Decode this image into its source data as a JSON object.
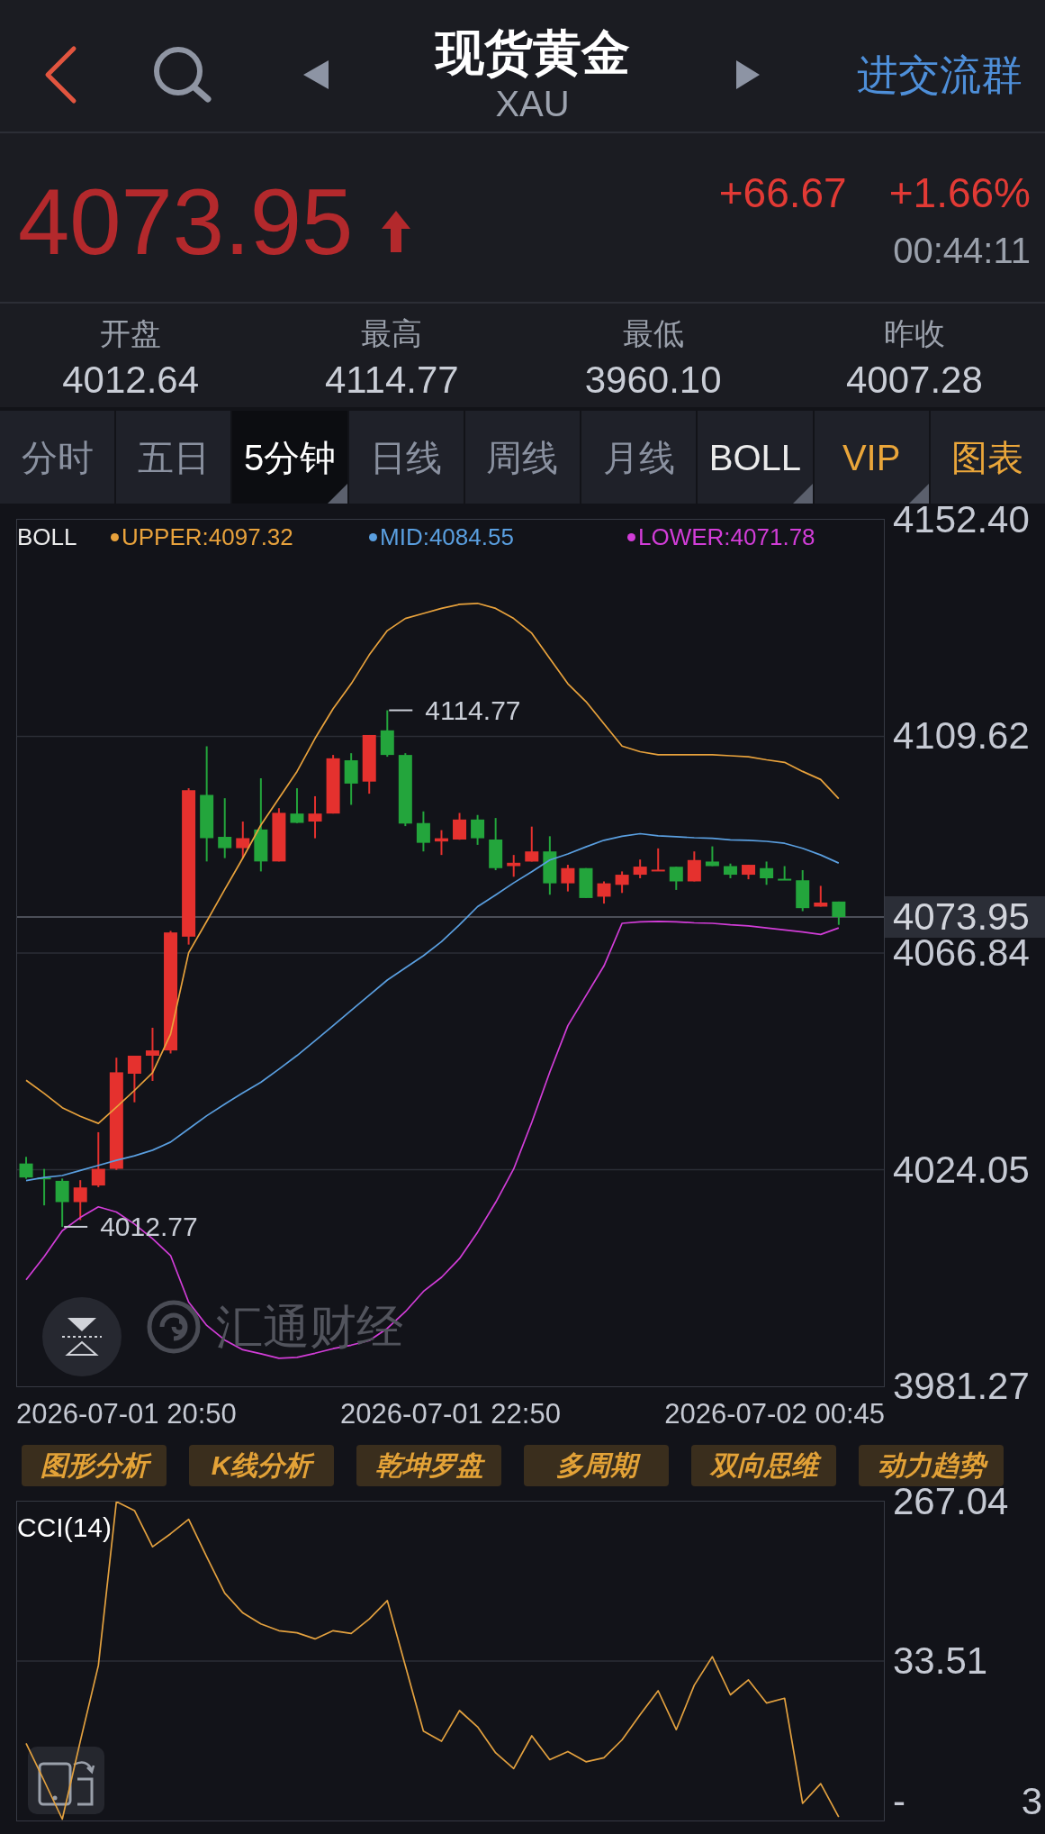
{
  "header": {
    "title": "现货黄金",
    "symbol": "XAU",
    "group_link": "进交流群"
  },
  "quote": {
    "price": "4073.95",
    "up": true,
    "change": "+66.67",
    "change_percent": "+1.66%",
    "time": "00:44:11"
  },
  "stats": [
    {
      "label": "开盘",
      "value": "4012.64"
    },
    {
      "label": "最高",
      "value": "4114.77"
    },
    {
      "label": "最低",
      "value": "3960.10"
    },
    {
      "label": "昨收",
      "value": "4007.28"
    }
  ],
  "tabs": [
    {
      "label": "分时",
      "selected": false,
      "kind": "period",
      "has_menu": false
    },
    {
      "label": "五日",
      "selected": false,
      "kind": "period",
      "has_menu": false
    },
    {
      "label": "5分钟",
      "selected": true,
      "kind": "period",
      "has_menu": true
    },
    {
      "label": "日线",
      "selected": false,
      "kind": "period",
      "has_menu": false
    },
    {
      "label": "周线",
      "selected": false,
      "kind": "period",
      "has_menu": false
    },
    {
      "label": "月线",
      "selected": false,
      "kind": "period",
      "has_menu": false
    },
    {
      "label": "BOLL",
      "selected": false,
      "kind": "indicator",
      "has_menu": true
    },
    {
      "label": "VIP",
      "selected": false,
      "kind": "premium",
      "has_menu": true
    },
    {
      "label": "图表",
      "selected": false,
      "kind": "premium",
      "has_menu": false
    }
  ],
  "main_chart": {
    "legend_title": "BOLL",
    "brand_mark": "汇通财经",
    "chart_data": {
      "type": "candlestick",
      "grid": true,
      "legend": "top",
      "categories": [
        null,
        null,
        null,
        null,
        null,
        null,
        null,
        null,
        null,
        null,
        null,
        null,
        null,
        null,
        null,
        null,
        null,
        null,
        null,
        null,
        null,
        null,
        null,
        null,
        null,
        null,
        null,
        null,
        null,
        null,
        null,
        null,
        null,
        null,
        null,
        null,
        null,
        null,
        null,
        null,
        null,
        null,
        null,
        null,
        null,
        null,
        null,
        null
      ],
      "ylim": [
        3981.27,
        4152.4
      ],
      "yticks": [
        {
          "value": 4152.4,
          "label": "4152.40"
        },
        {
          "value": 4109.62,
          "label": "4109.62"
        },
        {
          "value": 4066.84,
          "label": "4066.84"
        },
        {
          "value": 4024.05,
          "label": "4024.05"
        },
        {
          "value": 3981.27,
          "label": "3981.27"
        }
      ],
      "ohlc": [
        [
          4025.27,
          4026.58,
          4022.25,
          4022.51
        ],
        [
          4022.5,
          4024.2,
          4017.0,
          4022.4
        ],
        [
          4021.85,
          4022.3,
          4012.77,
          4017.65
        ],
        [
          4017.65,
          4021.98,
          4014.1,
          4020.54
        ],
        [
          4020.93,
          4031.45,
          4020.6,
          4024.22
        ],
        [
          4024.22,
          4046.17,
          4024.0,
          4043.28
        ],
        [
          4043.0,
          4046.56,
          4037.36,
          4046.56
        ],
        [
          4046.56,
          4052.08,
          4041.57,
          4047.6
        ],
        [
          4047.6,
          4071.2,
          4047.0,
          4070.9
        ],
        [
          4070.07,
          4099.38,
          4068.5,
          4098.99
        ],
        [
          4098.06,
          4107.66,
          4084.92,
          4089.52
        ],
        [
          4089.78,
          4097.41,
          4085.58,
          4087.55
        ],
        [
          4087.55,
          4092.8,
          4085.58,
          4089.52
        ],
        [
          4091.23,
          4101.35,
          4082.95,
          4084.92
        ],
        [
          4084.92,
          4095.44,
          4084.92,
          4094.52
        ],
        [
          4094.38,
          4099.38,
          4092.5,
          4092.54
        ],
        [
          4092.8,
          4097.8,
          4089.5,
          4094.38
        ],
        [
          4094.38,
          4105.95,
          4094.38,
          4105.29
        ],
        [
          4104.9,
          4106.3,
          4096.1,
          4100.3
        ],
        [
          4100.69,
          4109.89,
          4098.3,
          4109.89
        ],
        [
          4110.81,
          4114.77,
          4105.6,
          4105.95
        ],
        [
          4105.95,
          4106.3,
          4091.9,
          4092.4
        ],
        [
          4092.5,
          4094.8,
          4086.9,
          4088.6
        ],
        [
          4088.87,
          4091.1,
          4086.2,
          4089.5
        ],
        [
          4089.25,
          4094.5,
          4089.2,
          4093.2
        ],
        [
          4093.2,
          4094.1,
          4088.2,
          4089.5
        ],
        [
          4089.25,
          4093.5,
          4083.2,
          4083.6
        ],
        [
          4084.0,
          4086.2,
          4081.9,
          4084.66
        ],
        [
          4084.9,
          4091.8,
          4084.9,
          4086.9
        ],
        [
          4086.9,
          4089.9,
          4078.35,
          4080.6
        ],
        [
          4080.6,
          4084.26,
          4079.0,
          4083.6
        ],
        [
          4083.6,
          4083.6,
          4077.7,
          4077.7
        ],
        [
          4077.96,
          4080.98,
          4076.6,
          4080.6
        ],
        [
          4080.3,
          4082.95,
          4078.7,
          4082.3
        ],
        [
          4082.3,
          4085.3,
          4081.6,
          4083.9
        ],
        [
          4083.2,
          4087.5,
          4083.2,
          4083.3
        ],
        [
          4083.87,
          4083.87,
          4079.3,
          4080.98
        ],
        [
          4080.98,
          4086.9,
          4080.98,
          4085.2
        ],
        [
          4084.9,
          4087.9,
          4084.0,
          4084.0
        ],
        [
          4084.0,
          4084.5,
          4081.6,
          4082.3
        ],
        [
          4082.3,
          4084.26,
          4081.4,
          4084.26
        ],
        [
          4083.6,
          4084.9,
          4080.3,
          4081.6
        ],
        [
          4081.5,
          4084.0,
          4081.4,
          4081.4
        ],
        [
          4081.2,
          4083.2,
          4075.1,
          4075.7
        ],
        [
          4076.0,
          4080.1,
          4076.0,
          4076.8
        ],
        [
          4077.0,
          4077.0,
          4072.4,
          4073.95
        ],
        null,
        null
      ],
      "series": [
        {
          "name": "UPPER:4097.32",
          "type": "line",
          "color": "#e8a23c",
          "values": [
            4041.7,
            4039.1,
            4036.3,
            4034.6,
            4033.2,
            4036.4,
            4039.7,
            4043.2,
            4050.8,
            4066.9,
            4073.1,
            4079.4,
            4085.6,
            4092.1,
            4097.4,
            4102.7,
            4109.2,
            4115.1,
            4120.0,
            4125.7,
            4130.5,
            4132.9,
            4133.9,
            4134.9,
            4135.7,
            4135.9,
            4134.9,
            4132.9,
            4130.0,
            4125.0,
            4120.0,
            4116.5,
            4112.1,
            4107.7,
            4106.6,
            4106.0,
            4106.0,
            4106.0,
            4106.0,
            4105.8,
            4105.6,
            4105.0,
            4104.5,
            4102.7,
            4101.1,
            4097.3,
            null,
            null
          ]
        },
        {
          "name": "MID:4084.55",
          "type": "line",
          "color": "#5a9fe0",
          "values": [
            4021.9,
            4022.5,
            4022.9,
            4023.9,
            4024.9,
            4025.9,
            4026.8,
            4027.9,
            4029.5,
            4032.1,
            4034.7,
            4037.0,
            4039.2,
            4041.3,
            4043.9,
            4046.6,
            4049.5,
            4052.5,
            4055.5,
            4058.5,
            4061.5,
            4063.9,
            4066.3,
            4069.1,
            4072.4,
            4076.0,
            4078.3,
            4080.7,
            4082.9,
            4085.2,
            4086.4,
            4087.8,
            4089.1,
            4089.9,
            4090.4,
            4090.0,
            4089.8,
            4089.6,
            4089.5,
            4089.2,
            4089.1,
            4088.9,
            4088.5,
            4087.5,
            4086.2,
            4084.6,
            null,
            null
          ]
        },
        {
          "name": "LOWER:4071.78",
          "type": "line",
          "color": "#d23dd8",
          "values": [
            4002.3,
            4006.9,
            4012.0,
            4014.6,
            4016.7,
            4015.7,
            4013.3,
            4010.4,
            4007.1,
            3997.9,
            3993.3,
            3990.4,
            3988.5,
            3987.7,
            3986.8,
            3987.0,
            3987.8,
            3988.7,
            3989.4,
            3990.3,
            3992.7,
            3996.0,
            4000.0,
            4002.8,
            4006.5,
            4011.7,
            4017.6,
            4024.2,
            4033.4,
            4043.3,
            4052.5,
            4058.4,
            4064.3,
            4072.7,
            4073.0,
            4073.1,
            4073.0,
            4072.8,
            4072.7,
            4072.4,
            4072.2,
            4071.8,
            4071.4,
            4071.0,
            4070.5,
            4071.8,
            null,
            null
          ]
        }
      ],
      "ref_lines": [
        {
          "axis": "y",
          "value": 4073.95,
          "label": "4073.95"
        }
      ],
      "annotations": [
        "4114.77",
        "4012.77"
      ]
    },
    "time_axis": [
      "2026-07-01 20:50",
      "2026-07-01 22:50",
      "2026-07-02 00:45"
    ]
  },
  "tool_buttons": [
    "图形分析",
    "K线分析",
    "乾坤罗盘",
    "多周期",
    "双向思维",
    "动力趋势"
  ],
  "cci_chart": {
    "bottom_label_parts": [
      "-",
      "3"
    ],
    "chart_data": {
      "type": "line",
      "grid": true,
      "legend": "top",
      "categories": [
        null,
        null,
        null,
        null,
        null,
        null,
        null,
        null,
        null,
        null,
        null,
        null,
        null,
        null,
        null,
        null,
        null,
        null,
        null,
        null,
        null,
        null,
        null,
        null,
        null,
        null,
        null,
        null,
        null,
        null,
        null,
        null,
        null,
        null,
        null,
        null,
        null,
        null,
        null,
        null,
        null,
        null,
        null,
        null,
        null,
        null,
        null,
        null
      ],
      "ylim": [
        -200.02,
        267.04
      ],
      "yticks": [
        {
          "value": 267.04,
          "label": "267.04"
        },
        {
          "value": 33.51,
          "label": "33.51"
        }
      ],
      "series": [
        {
          "name": "CCI(14)",
          "color": "#e3a13f",
          "values": [
            -87,
            -142,
            -198,
            -84,
            27,
            267,
            254,
            201,
            220,
            241,
            186,
            133,
            104,
            88,
            78,
            75,
            66,
            78,
            74,
            95,
            122,
            27,
            -69,
            -84,
            -39,
            -63,
            -101,
            -124,
            -76,
            -111,
            -99,
            -114,
            -108,
            -82,
            -45,
            -10,
            -67,
            -2,
            40,
            -16,
            6,
            -28,
            -21,
            -175,
            -146,
            -195,
            null,
            null
          ]
        }
      ]
    }
  }
}
